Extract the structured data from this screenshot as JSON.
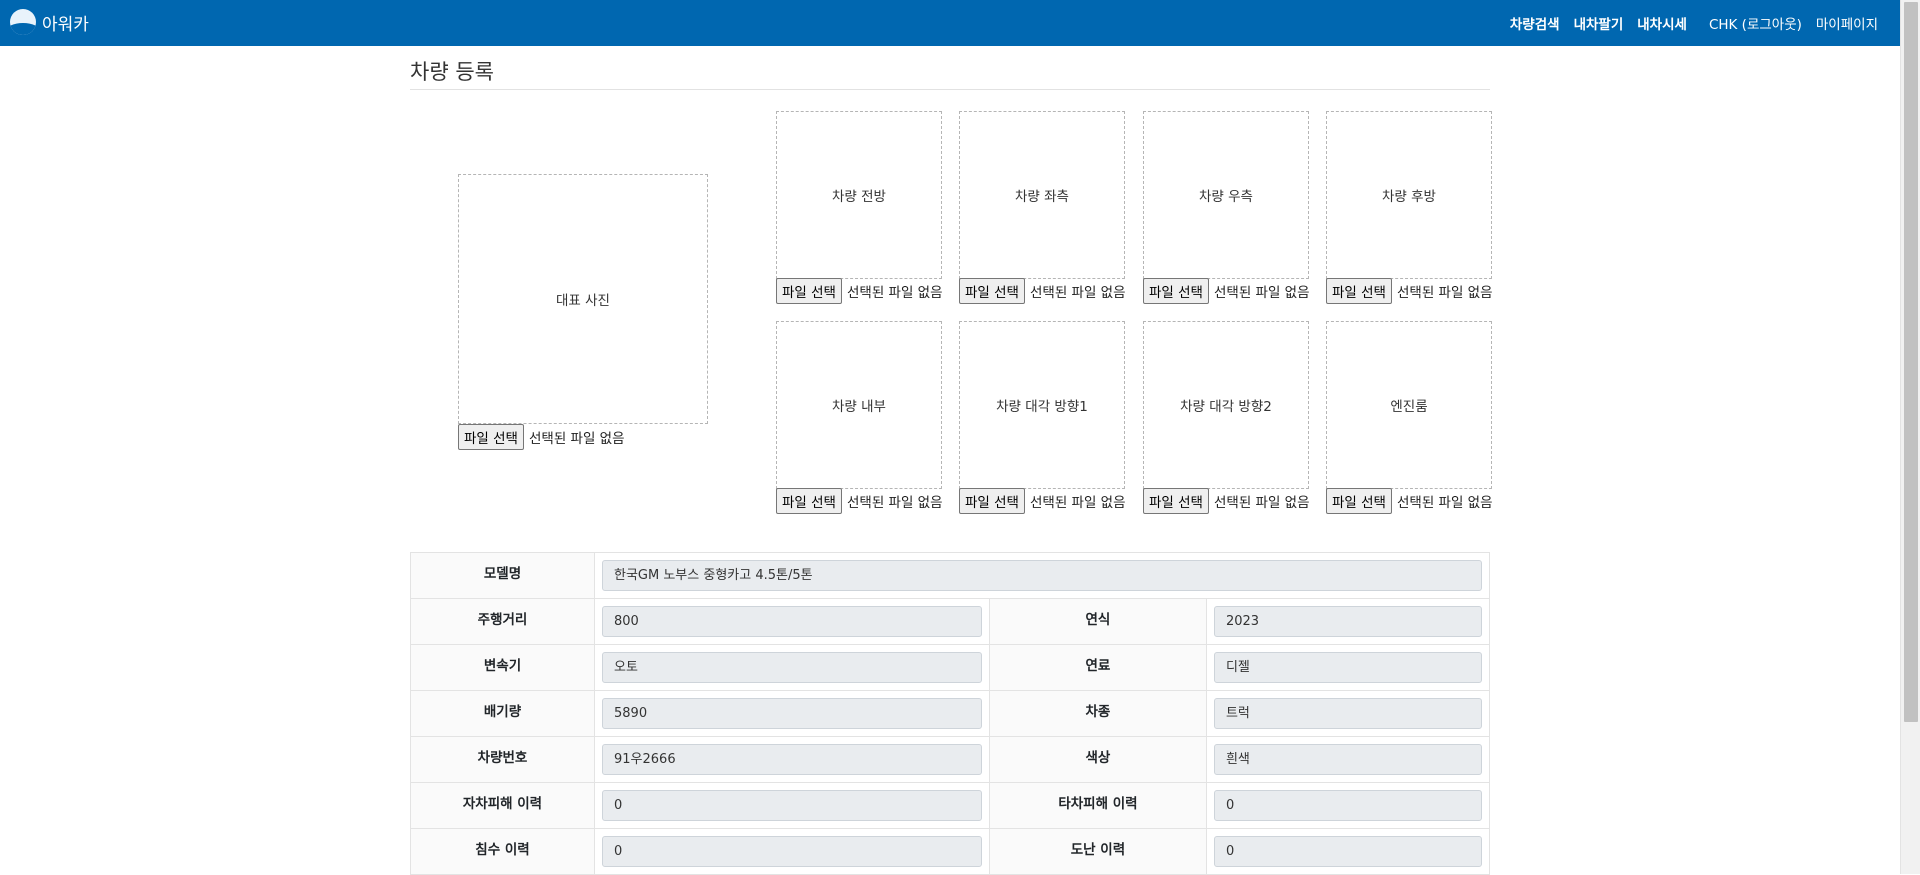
{
  "brand": {
    "name": "아워카"
  },
  "nav": {
    "links": [
      "차량검색",
      "내차팔기",
      "내차시세"
    ],
    "user": "CHK (로그아웃)",
    "mypage": "마이페이지"
  },
  "page": {
    "title": "차량 등록"
  },
  "file_input": {
    "button": "파일 선택",
    "status": "선택된 파일 없음"
  },
  "photos": {
    "main": "대표 사진",
    "slots": [
      "차량 전방",
      "차량 좌측",
      "차량 우측",
      "차량 후방",
      "차량 내부",
      "차량 대각 방향1",
      "차량 대각 방향2",
      "엔진룸"
    ]
  },
  "details": {
    "model": {
      "label": "모델명",
      "value": "한국GM 노부스 중형카고 4.5톤/5톤"
    },
    "rows": [
      {
        "l1": "주행거리",
        "v1": "800",
        "l2": "연식",
        "v2": "2023"
      },
      {
        "l1": "변속기",
        "v1": "오토",
        "l2": "연료",
        "v2": "디젤"
      },
      {
        "l1": "배기량",
        "v1": "5890",
        "l2": "차종",
        "v2": "트럭"
      },
      {
        "l1": "차량번호",
        "v1": "91우2666",
        "l2": "색상",
        "v2": "흰색"
      },
      {
        "l1": "자차피해 이력",
        "v1": "0",
        "l2": "타차피해 이력",
        "v2": "0"
      },
      {
        "l1": "침수 이력",
        "v1": "0",
        "l2": "도난 이력",
        "v2": "0"
      }
    ]
  },
  "colors": {
    "navbar": "#0067b0",
    "label_bg": "#fafafa",
    "readonly_bg": "#e9ecef"
  }
}
